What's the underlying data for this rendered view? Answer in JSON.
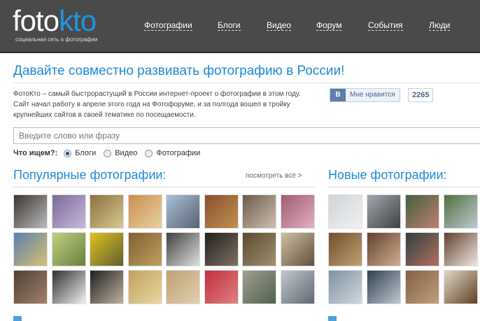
{
  "header": {
    "logo_a": "foto",
    "logo_b": "kto",
    "tagline": "социальная сеть о фотографии",
    "nav": [
      "Фотографии",
      "Блоги",
      "Видео",
      "Форум",
      "События",
      "Люди"
    ]
  },
  "headline": "Давайте совместно развивать фотографию в России!",
  "intro": "ФотоКто – самый быстрорастущий в России интернет-проект о фотографии в этом году. Сайт начал работу в апреле этого года на Фотофоруме, и за полгода вошел в тройку крупнейших сайтов в своей тематике по посещаемости.",
  "vk": {
    "icon": "В",
    "label": "Мне нравится",
    "count": "2265"
  },
  "search": {
    "placeholder": "Введите слово или фразу",
    "label": "Что ищем?:",
    "options": [
      "Блоги",
      "Видео",
      "Фотографии"
    ],
    "selected": "Блоги"
  },
  "popular": {
    "title": "Популярные фотографии:",
    "more": "посмотреть всё >"
  },
  "new": {
    "title": "Новые фотографии:"
  },
  "colors": {
    "accent": "#1e8ad6",
    "header": "#4a4a4a"
  }
}
